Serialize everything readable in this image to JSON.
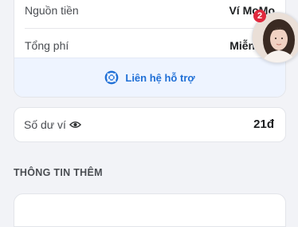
{
  "summary": {
    "rows": [
      {
        "label": "Nguồn tiền",
        "value": "Ví MoMo"
      },
      {
        "label": "Tổng phí",
        "value": "Miễn phí"
      }
    ],
    "support_label": "Liên hệ hỗ trợ"
  },
  "avatar_badge": "2",
  "balance": {
    "label": "Số dư ví",
    "value": "21đ"
  },
  "section_title": "THÔNG TIN THÊM",
  "colors": {
    "accent": "#1f6fd6",
    "badge": "#e0283d",
    "support_bg": "#eef4ff"
  }
}
